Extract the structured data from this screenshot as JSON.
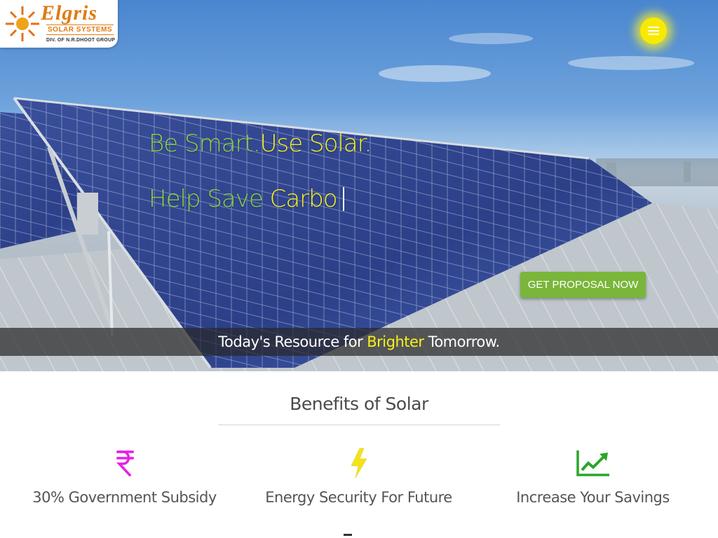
{
  "logo": {
    "brand": "Elgris",
    "sub": "SOLAR SYSTEMS",
    "division": "DIV. OF N.R.DHOOT GROUP"
  },
  "hero": {
    "line1_green": "Be Smart.",
    "line1_yellow": "Use Solar.",
    "line2_green": "Help Save ",
    "line2_yellow": "Carbo",
    "cta_label": "GET PROPOSAL NOW",
    "tagline_before": "Today's Resource for",
    "tagline_highlight": "Brighter",
    "tagline_after": "Tomorrow."
  },
  "benefits": {
    "title": "Benefits of Solar",
    "items": [
      {
        "label": "30% Government Subsidy",
        "icon": "rupee-icon",
        "color": "#e61ee6"
      },
      {
        "label": "Energy Security For Future",
        "icon": "lightning-bolt-icon",
        "color": "#f2e31c"
      },
      {
        "label": "Increase Your Savings",
        "icon": "line-chart-icon",
        "color": "#2aa52a"
      }
    ]
  },
  "colors": {
    "accent_green": "#79b63a",
    "headline_green": "#8bd23c",
    "highlight_yellow": "#f6f01a",
    "menu_yellow": "#f7ea00"
  }
}
